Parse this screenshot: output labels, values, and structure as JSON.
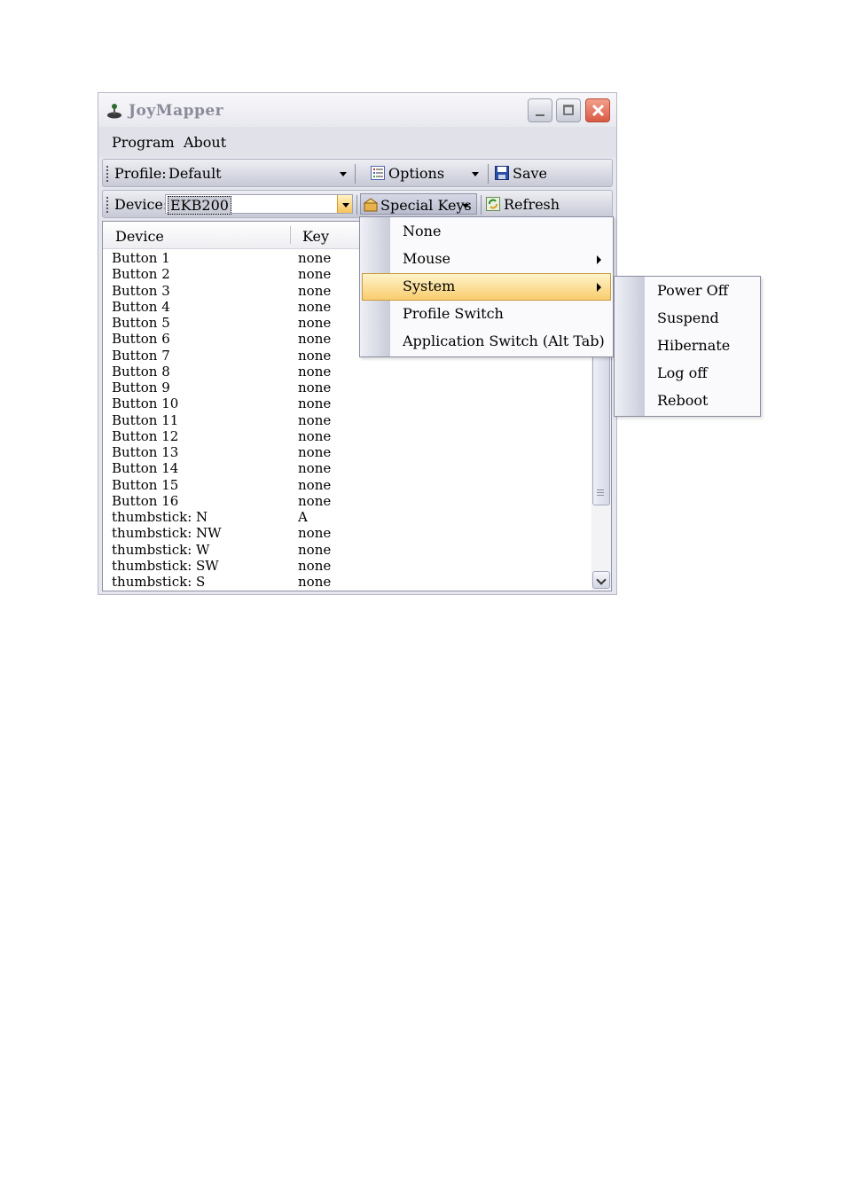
{
  "window": {
    "title": "JoyMapper"
  },
  "menubar": {
    "items": [
      "Program",
      "About"
    ]
  },
  "toolbar1": {
    "profile_label": "Profile:",
    "profile_value": "Default",
    "options_label": "Options",
    "save_label": "Save"
  },
  "toolbar2": {
    "device_label": "Device:",
    "device_value": "EKB200",
    "special_keys_label": "Special Keys",
    "refresh_label": "Refresh"
  },
  "list": {
    "columns": [
      "Device",
      "Key"
    ],
    "rows": [
      {
        "device": "Button 1",
        "key": "none"
      },
      {
        "device": "Button 2",
        "key": "none"
      },
      {
        "device": "Button 3",
        "key": "none"
      },
      {
        "device": "Button 4",
        "key": "none"
      },
      {
        "device": "Button 5",
        "key": "none"
      },
      {
        "device": "Button 6",
        "key": "none"
      },
      {
        "device": "Button 7",
        "key": "none"
      },
      {
        "device": "Button 8",
        "key": "none"
      },
      {
        "device": "Button 9",
        "key": "none"
      },
      {
        "device": "Button 10",
        "key": "none"
      },
      {
        "device": "Button 11",
        "key": "none"
      },
      {
        "device": "Button 12",
        "key": "none"
      },
      {
        "device": "Button 13",
        "key": "none"
      },
      {
        "device": "Button 14",
        "key": "none"
      },
      {
        "device": "Button 15",
        "key": "none"
      },
      {
        "device": "Button 16",
        "key": "none"
      },
      {
        "device": "thumbstick: N",
        "key": "A"
      },
      {
        "device": "thumbstick: NW",
        "key": "none"
      },
      {
        "device": "thumbstick: W",
        "key": "none"
      },
      {
        "device": "thumbstick: SW",
        "key": "none"
      },
      {
        "device": "thumbstick: S",
        "key": "none"
      }
    ]
  },
  "special_keys_menu": {
    "items": [
      "None",
      "Mouse",
      "System",
      "Profile Switch",
      "Application Switch (Alt Tab)"
    ],
    "highlighted": "System"
  },
  "system_submenu": {
    "items": [
      "Power Off",
      "Suspend",
      "Hibernate",
      "Log off",
      "Reboot"
    ]
  },
  "colors": {
    "highlight": "#f9cd6f",
    "close_button": "#d95a43"
  }
}
